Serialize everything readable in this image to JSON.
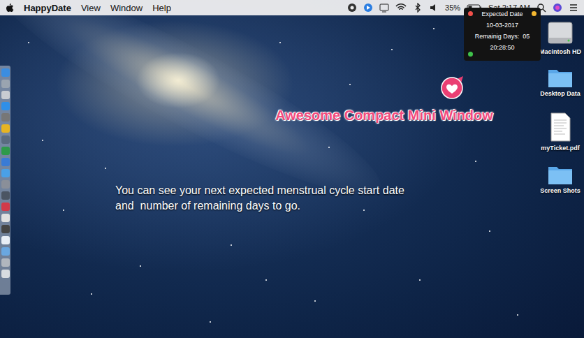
{
  "menu_bar": {
    "app": "HappyDate",
    "menus": [
      "View",
      "Window",
      "Help"
    ],
    "battery": "35%",
    "clock": "Sat 2:17 AM"
  },
  "mini_window": {
    "title": "Expected Date",
    "date": "10-03-2017",
    "remaining_label": "Remainig Days:",
    "remaining_value": "05",
    "time": "20:28:50"
  },
  "desktop_icons": [
    {
      "label": "Macintosh HD",
      "kind": "drive"
    },
    {
      "label": "Desktop Data",
      "kind": "folder"
    },
    {
      "label": "myTicket.pdf",
      "kind": "document"
    },
    {
      "label": "Screen Shots",
      "kind": "folder"
    }
  ],
  "callout": "Awesome Compact Mini Window",
  "caption": [
    "You can see your next expected menstrual cycle start date",
    "and  number of remaining days to go."
  ]
}
